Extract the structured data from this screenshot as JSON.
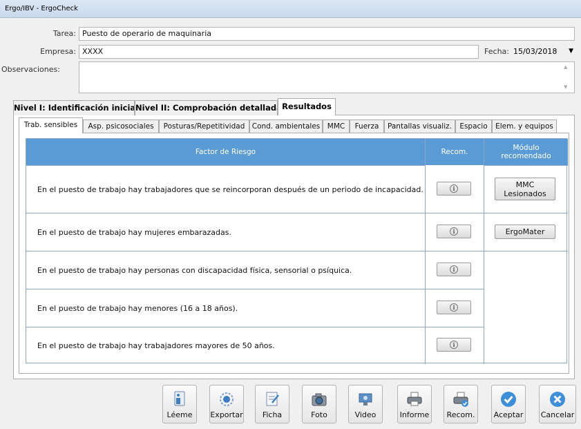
{
  "window": {
    "title": "Ergo/IBV - ErgoCheck"
  },
  "form": {
    "tarea_label": "Tarea:",
    "tarea_value": "Puesto de operario de maquinaria",
    "empresa_label": "Empresa:",
    "empresa_value": "XXXX",
    "fecha_label": "Fecha:",
    "fecha_value": "15/03/2018",
    "observaciones_label": "Observaciones:",
    "observaciones_value": ""
  },
  "outer_tabs": [
    {
      "label": "Nivel I: Identificación inicial"
    },
    {
      "label": "Nivel II: Comprobación detallada"
    },
    {
      "label": "Resultados"
    }
  ],
  "inner_tabs": [
    {
      "label": "Trab. sensibles"
    },
    {
      "label": "Asp. psicosociales"
    },
    {
      "label": "Posturas/Repetitividad"
    },
    {
      "label": "Cond. ambientales"
    },
    {
      "label": "MMC"
    },
    {
      "label": "Fuerza"
    },
    {
      "label": "Pantallas visualiz."
    },
    {
      "label": "Espacio"
    },
    {
      "label": "Elem. y equipos"
    }
  ],
  "table": {
    "headers": {
      "factor": "Factor de Riesgo",
      "recom": "Recom.",
      "modulo": "Módulo recomendado"
    },
    "rows": [
      {
        "text": "En el puesto de trabajo hay trabajadores que se reincorporan después de un periodo de incapacidad."
      },
      {
        "text": "En el puesto de trabajo hay mujeres embarazadas."
      },
      {
        "text": "En el puesto de trabajo hay personas con discapacidad física, sensorial o psíquica."
      },
      {
        "text": "En el puesto de trabajo hay menores (16 a 18 años)."
      },
      {
        "text": "En el puesto de trabajo hay trabajadores mayores de 50 años."
      }
    ],
    "modules": {
      "mmc_lesionados": "MMC Lesionados",
      "ergomater": "ErgoMater"
    }
  },
  "toolbar": {
    "leeme": "Léeme",
    "exportar": "Exportar",
    "ficha": "Ficha",
    "foto": "Foto",
    "video": "Video",
    "informe": "Informe",
    "recom": "Recom.",
    "aceptar": "Aceptar",
    "cancelar": "Cancelar"
  },
  "colors": {
    "header_bg": "#5b9bd5",
    "grid_line": "#8aa7c8",
    "accept": "#3c8fd8"
  }
}
